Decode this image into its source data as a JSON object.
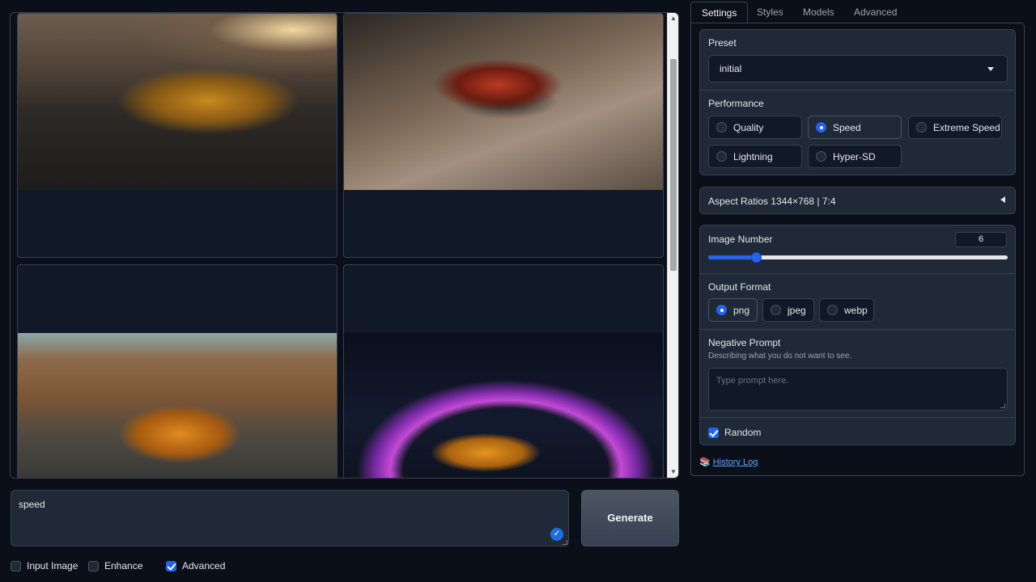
{
  "prompt": {
    "value": "speed"
  },
  "generate": {
    "label": "Generate"
  },
  "options": {
    "input_image": "Input Image",
    "enhance": "Enhance",
    "advanced": "Advanced"
  },
  "tabs": [
    "Settings",
    "Styles",
    "Models",
    "Advanced"
  ],
  "preset": {
    "label": "Preset",
    "value": "initial"
  },
  "performance": {
    "label": "Performance",
    "options": [
      "Quality",
      "Speed",
      "Extreme Speed",
      "Lightning",
      "Hyper-SD"
    ],
    "selected": "Speed"
  },
  "aspect_ratios": {
    "label": "Aspect Ratios 1344×768 | 7:4"
  },
  "image_number": {
    "label": "Image Number",
    "value": "6",
    "fraction": 0.16
  },
  "output_format": {
    "label": "Output Format",
    "options": [
      "png",
      "jpeg",
      "webp"
    ],
    "selected": "png"
  },
  "negative_prompt": {
    "label": "Negative Prompt",
    "hint": "Describing what you do not want to see.",
    "placeholder": "Type prompt here."
  },
  "random": {
    "label": "Random"
  },
  "history": {
    "label": "History Log"
  },
  "colors": {
    "accent": "#2563eb",
    "background": "#0b0f19",
    "panel": "#1f2937"
  }
}
